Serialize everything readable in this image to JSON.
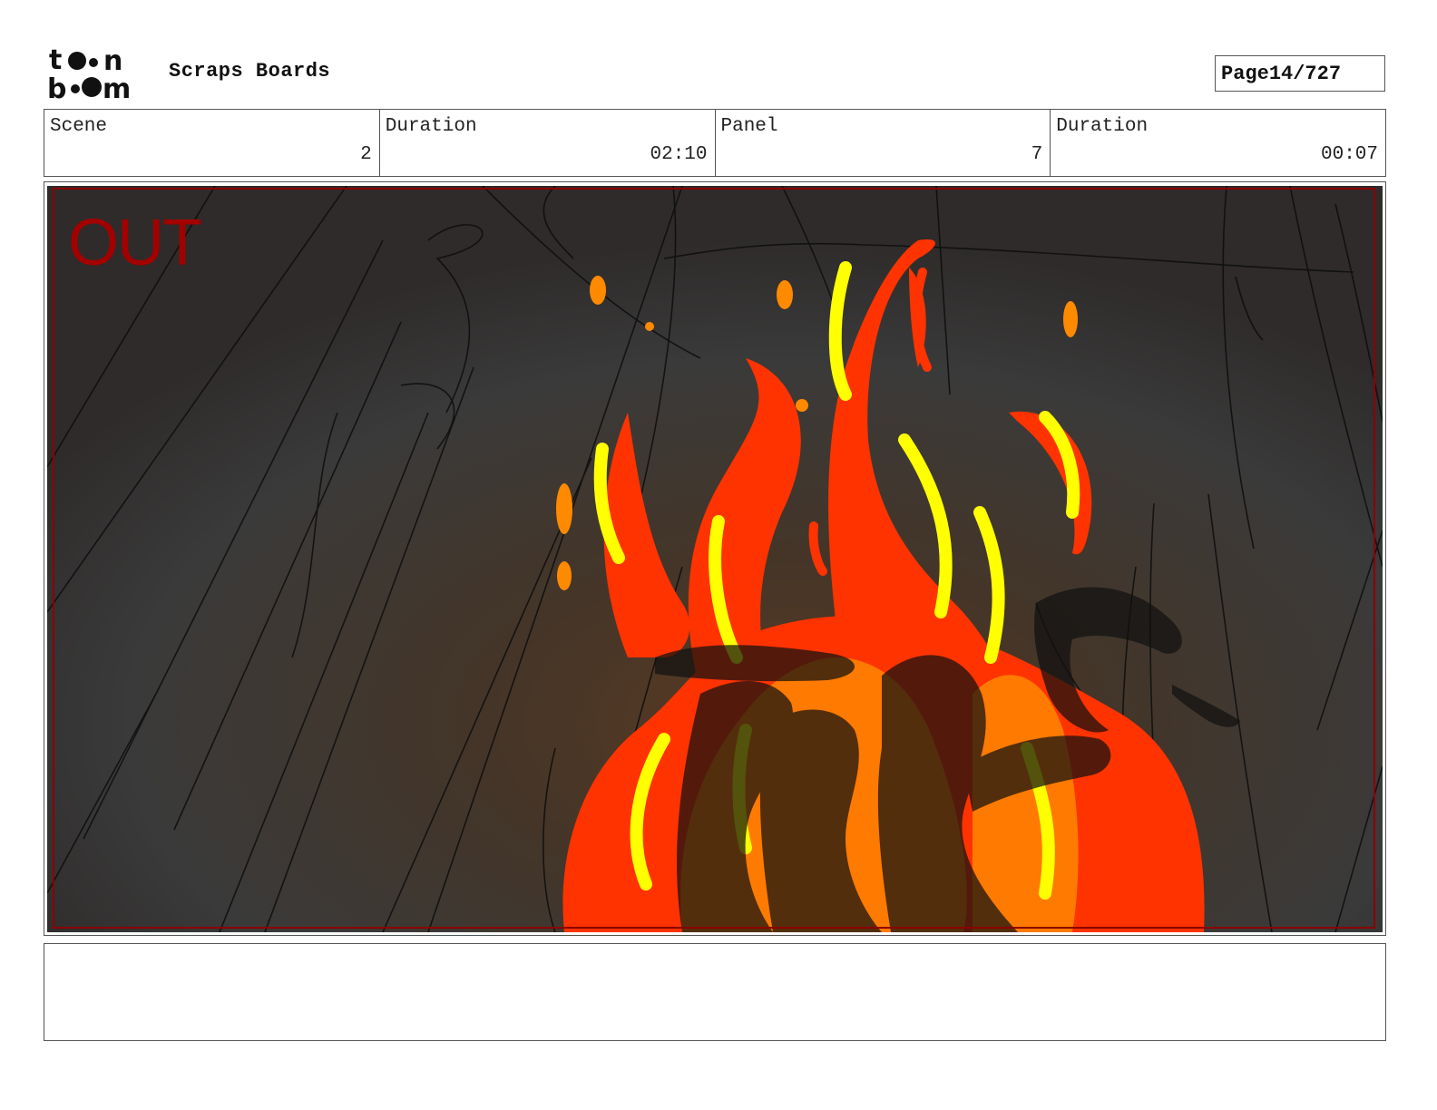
{
  "header": {
    "logo_text_top": "toon",
    "logo_text_bottom": "boom",
    "title": "Scraps Boards",
    "page_label": "Page",
    "page_value": "14/727"
  },
  "info": {
    "scene_label": "Scene",
    "scene_value": "2",
    "scene_duration_label": "Duration",
    "scene_duration_value": "02:10",
    "panel_label": "Panel",
    "panel_value": "7",
    "panel_duration_label": "Duration",
    "panel_duration_value": "00:07"
  },
  "panel": {
    "overlay_label": "OUT",
    "overlay_color": "#a30000",
    "frame_line_color": "#8b0000"
  },
  "notes": {
    "text": ""
  },
  "colors": {
    "fire_red": "#ff3300",
    "fire_orange": "#ff7a00",
    "fire_yellow": "#ffff00",
    "background_dark": "#3b3b3b"
  }
}
